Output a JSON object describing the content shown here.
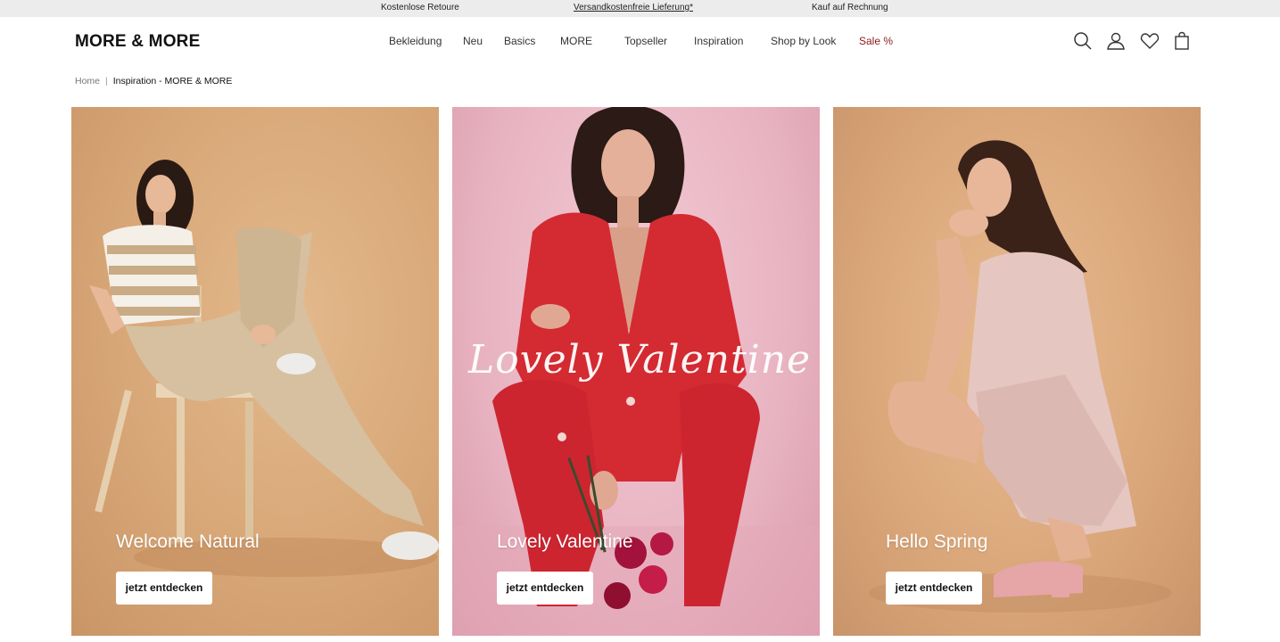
{
  "topbar": {
    "item1": "Kostenlose Retoure",
    "item2": "Versandkostenfreie Lieferung*",
    "item3": "Kauf auf Rechnung"
  },
  "header": {
    "logo": "MORE & MORE",
    "nav": [
      "Bekleidung",
      "Neu",
      "Basics",
      "MORE",
      "Topseller",
      "Inspiration",
      "Shop by Look",
      "Sale %"
    ],
    "icons": [
      "search-icon",
      "account-icon",
      "wishlist-icon",
      "cart-icon"
    ]
  },
  "breadcrumb": {
    "home": "Home",
    "separator": "|",
    "current": "Inspiration - MORE & MORE"
  },
  "cards": [
    {
      "title": "Welcome Natural",
      "button": "jetzt entdecken",
      "bg": "#d8a777"
    },
    {
      "title": "Lovely Valentine",
      "button": "jetzt entdecken",
      "overlay_script": "Lovely Valentine",
      "bg": "#e8b3c1"
    },
    {
      "title": "Hello Spring",
      "button": "jetzt entdecken",
      "bg": "#d9a679"
    }
  ],
  "colors": {
    "topbar_bg": "#ececec",
    "sale": "#8b1a1a",
    "suit_red": "#d42a32"
  }
}
